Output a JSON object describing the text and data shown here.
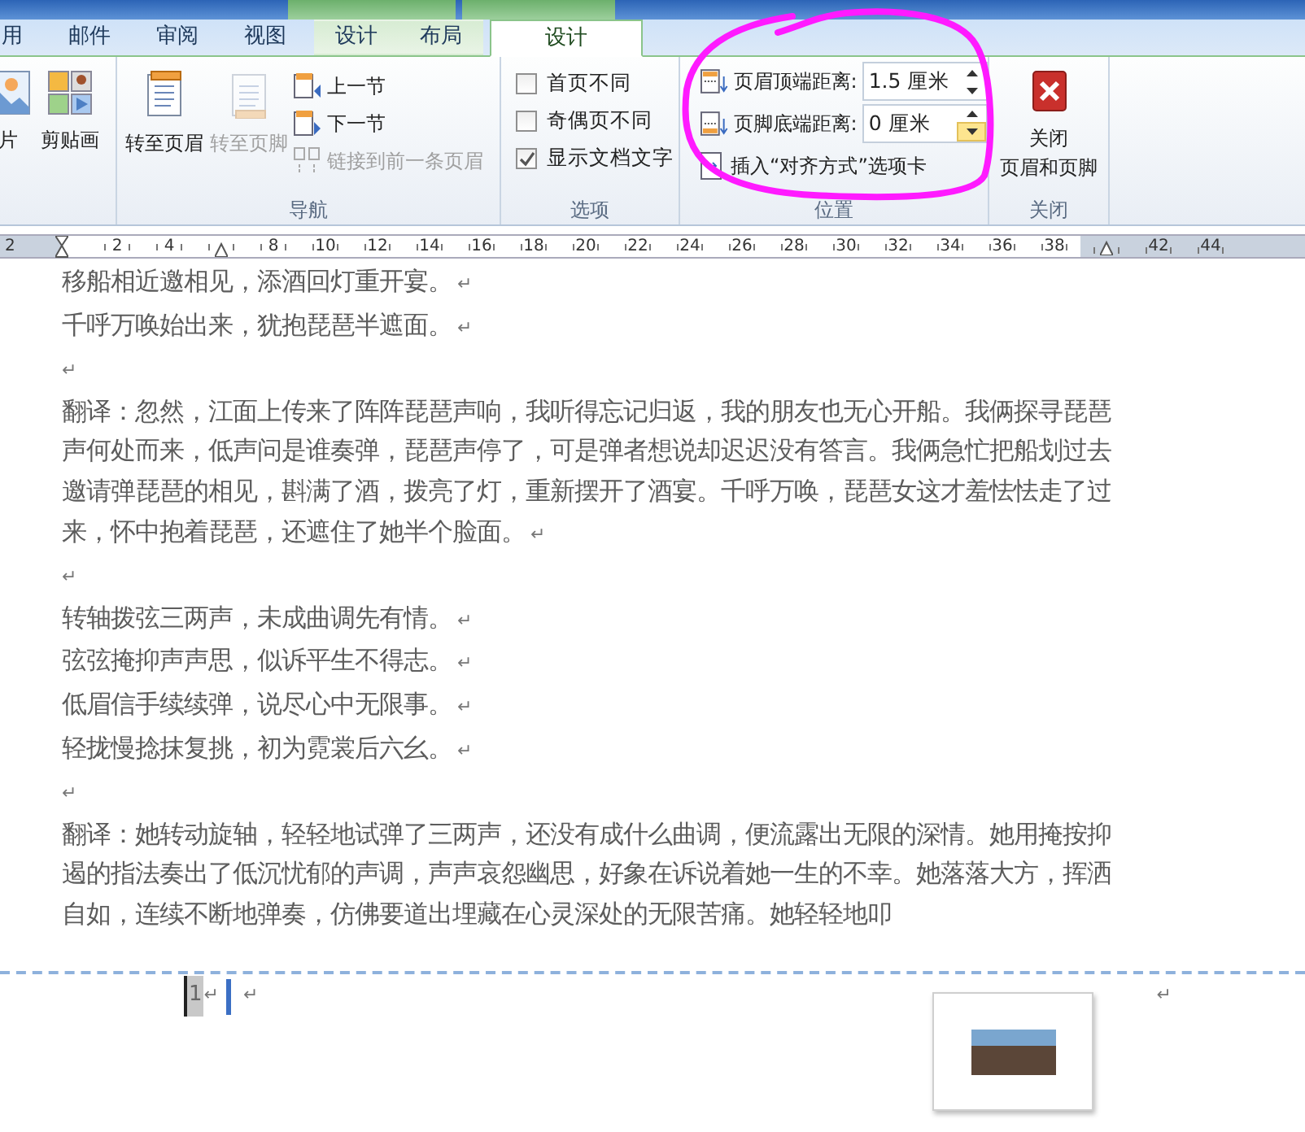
{
  "ribbon_tabs": [
    {
      "label": "用",
      "contextual": false,
      "selected": false
    },
    {
      "label": "邮件",
      "contextual": false,
      "selected": false
    },
    {
      "label": "审阅",
      "contextual": false,
      "selected": false
    },
    {
      "label": "视图",
      "contextual": false,
      "selected": false
    },
    {
      "label": "设计",
      "contextual": true,
      "selected": false
    },
    {
      "label": "布局",
      "contextual": true,
      "selected": false
    },
    {
      "label": "设计",
      "contextual": true,
      "selected": true
    }
  ],
  "insert_group": {
    "buttons": [
      {
        "label": "片"
      },
      {
        "label": "剪贴画"
      }
    ]
  },
  "navigation_group": {
    "label": "导航",
    "large_buttons": [
      {
        "label": "转至页眉",
        "disabled": false
      },
      {
        "label": "转至页脚",
        "disabled": true
      }
    ],
    "small_buttons": [
      {
        "label": "上一节",
        "kind": "previous",
        "disabled": false
      },
      {
        "label": "下一节",
        "kind": "next",
        "disabled": false
      },
      {
        "label": "链接到前一条页眉",
        "kind": "link",
        "disabled": true
      }
    ]
  },
  "options_group": {
    "label": "选项",
    "checkboxes": [
      {
        "label": "首页不同",
        "checked": false
      },
      {
        "label": "奇偶页不同",
        "checked": false
      },
      {
        "label": "显示文档文字",
        "checked": true
      }
    ]
  },
  "position_group": {
    "label": "位置",
    "spinners": [
      {
        "label": "页眉顶端距离:",
        "kind": "header",
        "value": "1.5 厘米",
        "down_hovered": false
      },
      {
        "label": "页脚底端距离:",
        "kind": "footer",
        "value": "0 厘米",
        "down_hovered": true
      }
    ],
    "insert_tab_button": "插入“对齐方式”选项卡"
  },
  "close_group": {
    "label": "关闭",
    "button_lines": [
      "关闭",
      "页眉和页脚"
    ]
  },
  "ruler": {
    "left_margin_labels": [
      "2"
    ],
    "indent_labels": [
      "2",
      "4"
    ],
    "body_labels": [
      "8",
      "10",
      "12",
      "14",
      "16",
      "18",
      "20",
      "22",
      "24",
      "26",
      "28",
      "30",
      "32",
      "34",
      "36",
      "38"
    ],
    "right_margin_labels": [
      "42",
      "44"
    ]
  },
  "document": {
    "paragraphs": [
      {
        "text": "移船相近邀相见，添酒回灯重开宴。",
        "mark": "↵"
      },
      {
        "text": "千呼万唤始出来，犹抱琵琶半遮面。",
        "mark": "↵"
      },
      {
        "mark": "↵"
      },
      {
        "text": "翻译：忽然，江面上传来了阵阵琵琶声响，我听得忘记归返，我的朋友也无心开船。我俩探寻琵琶声何处而来，低声问是谁奏弹，琵琶声停了，可是弹者想说却迟迟没有答言。我俩急忙把船划过去邀请弹琵琶的相见，斟满了酒，拨亮了灯，重新摆开了酒宴。千呼万唤，琵琶女这才羞怯怯走了过来，怀中抱着琵琶，还遮住了她半个脸面。",
        "mark": "↵"
      },
      {
        "mark": "↵"
      },
      {
        "text": "转轴拨弦三两声，未成曲调先有情。",
        "mark": "↵"
      },
      {
        "text": "弦弦掩抑声声思，似诉平生不得志。",
        "mark": "↵"
      },
      {
        "text": "低眉信手续续弹，说尽心中无限事。",
        "mark": "↵"
      },
      {
        "text": "轻拢慢捻抹复挑，初为霓裳后六幺。",
        "mark": "↵"
      },
      {
        "mark": "↵"
      },
      {
        "text": "翻译：她转动旋轴，轻轻地试弹了三两声，还没有成什么曲调，便流露出无限的深情。她用掩按抑遏的指法奏出了低沉忧郁的声调，声声哀怨幽思，好象在诉说着她一生的不幸。她落落大方，挥洒自如，连续不断地弹奏，仿佛要道出埋藏在心灵深处的无限苦痛。她轻轻地叩"
      }
    ]
  },
  "footer": {
    "page_number": "1",
    "marks": [
      "↵",
      "↵",
      "↵"
    ]
  }
}
